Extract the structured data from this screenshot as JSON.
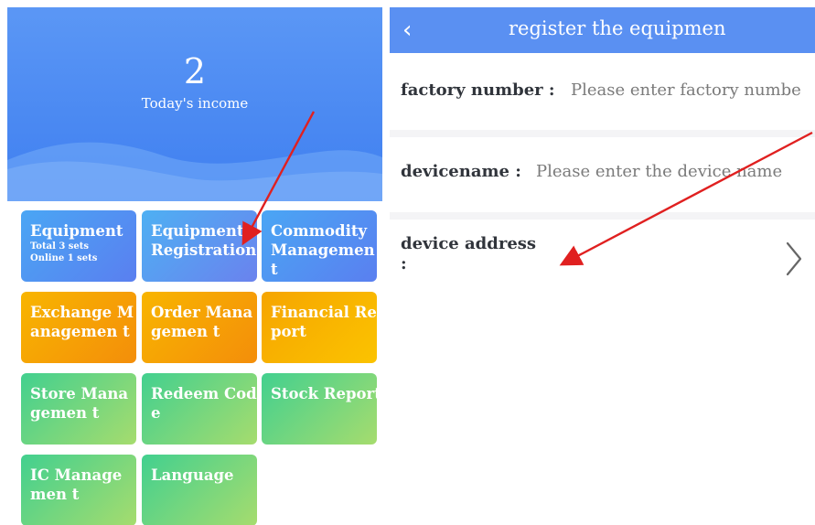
{
  "dashboard": {
    "income_value": "2",
    "income_label": "Today's income",
    "tiles": [
      {
        "label": "Equipment",
        "sub1": "Total 3 sets",
        "sub2": "Online 1 sets"
      },
      {
        "label": "Equipment Registration"
      },
      {
        "label": "Commodity Managemen t"
      },
      {
        "label": "Exchange Managemen t"
      },
      {
        "label": "Order Managemen t"
      },
      {
        "label": "Financial Report"
      },
      {
        "label": "Store Managemen t"
      },
      {
        "label": "Redeem Code"
      },
      {
        "label": "Stock Report"
      },
      {
        "label": "IC Managemen t"
      },
      {
        "label": "Language"
      }
    ]
  },
  "register": {
    "back_icon": "chevron-left-icon",
    "title": "register the equipmen",
    "factory_label": "factory number :",
    "factory_placeholder": "Please enter factory numbe",
    "devicename_label": "devicename :",
    "devicename_placeholder": "Please enter the device name",
    "address_label_line1": "device address",
    "address_label_line2": ":",
    "address_chevron_icon": "chevron-right-icon"
  },
  "annotation_color": "#e02020"
}
